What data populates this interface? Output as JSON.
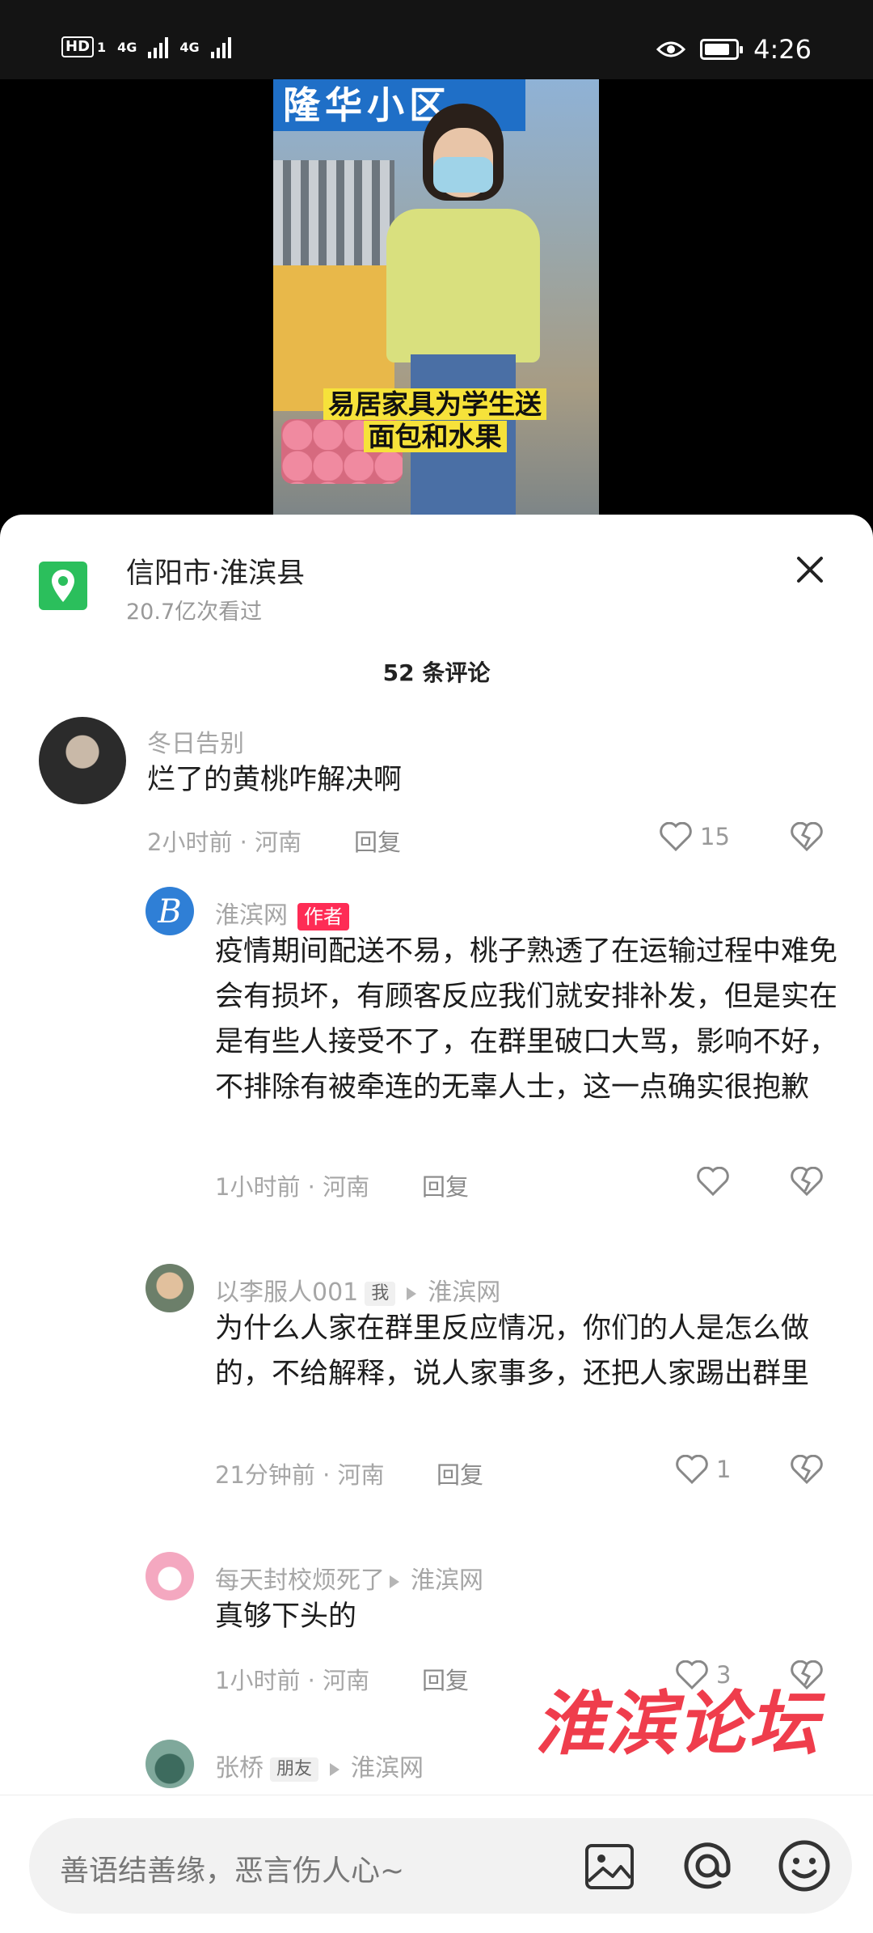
{
  "status_bar": {
    "hd": "HD",
    "sim1": "1",
    "net1": "4G",
    "net2": "4G",
    "time": "4:26"
  },
  "video": {
    "sign_text": "隆华小区",
    "caption_line1": "易居家具为学生送",
    "caption_line2": "面包和水果"
  },
  "location": {
    "title": "信阳市·淮滨县",
    "views": "20.7亿次看过",
    "icon": "location-pin-icon"
  },
  "comments_count": "52 条评论",
  "comments": [
    {
      "user": "冬日告别",
      "text": "烂了的黄桃咋解决啊",
      "meta": "2小时前 · 河南",
      "reply": "回复",
      "likes": "15"
    },
    {
      "user": "淮滨网",
      "tag": "作者",
      "text": "疫情期间配送不易，桃子熟透了在运输过程中难免会有损坏，有顾客反应我们就安排补发，但是实在是有些人接受不了，在群里破口大骂，影响不好，不排除有被牵连的无辜人士，这一点确实很抱歉",
      "meta": "1小时前 · 河南",
      "reply": "回复",
      "likes": ""
    },
    {
      "user": "以李服人001",
      "tag": "我",
      "reply_to": "淮滨网",
      "text": "为什么人家在群里反应情况，你们的人是怎么做的，不给解释，说人家事多，还把人家踢出群里",
      "meta": "21分钟前 · 河南",
      "reply": "回复",
      "likes": "1"
    },
    {
      "user": "每天封校烦死了",
      "reply_to": "淮滨网",
      "text": "真够下头的",
      "meta": "1小时前 · 河南",
      "reply": "回复",
      "likes": "3"
    },
    {
      "user": "张桥",
      "tag": "朋友",
      "reply_to": "淮滨网"
    }
  ],
  "watermark": "淮滨论坛",
  "input": {
    "placeholder": "善语结善缘，恶言伤人心~",
    "icons": [
      "image-icon",
      "at-mention-icon",
      "emoji-icon"
    ]
  },
  "colors": {
    "accent_red": "#fe2c55",
    "location_green": "#2bbf5c",
    "watermark_red": "#ee2d3d"
  }
}
